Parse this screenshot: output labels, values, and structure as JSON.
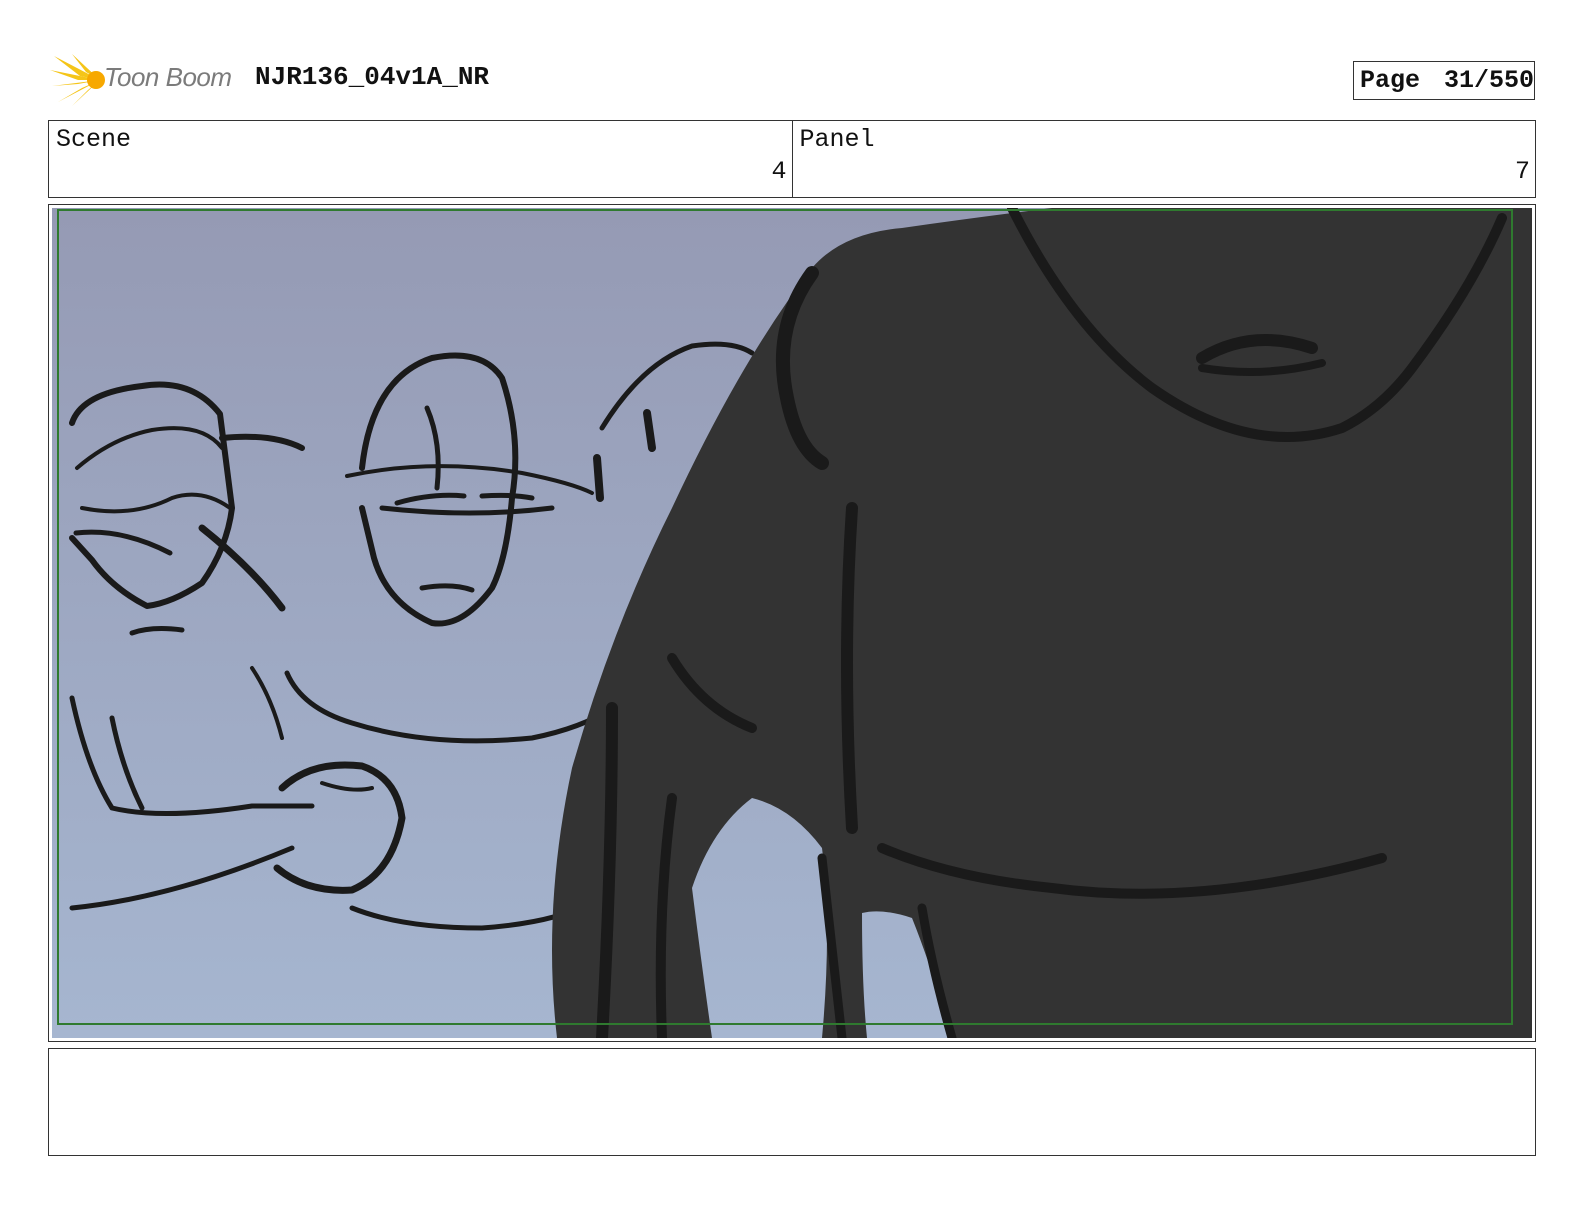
{
  "header": {
    "logo_text": "Toon Boom",
    "project_title": "NJR136_04v1A_NR",
    "page_label": "Page",
    "page_number": "31/550"
  },
  "info": {
    "scene_label": "Scene",
    "scene_value": "4",
    "panel_label": "Panel",
    "panel_value": "7"
  },
  "colors": {
    "sky_top": "#959ab4",
    "sky_bottom": "#a6b6d0",
    "silhouette": "#333333",
    "line_art": "#1a1a1a",
    "safe_frame": "#2f7a2f",
    "logo_yellow": "#f5c518"
  },
  "notes": {
    "text": ""
  }
}
